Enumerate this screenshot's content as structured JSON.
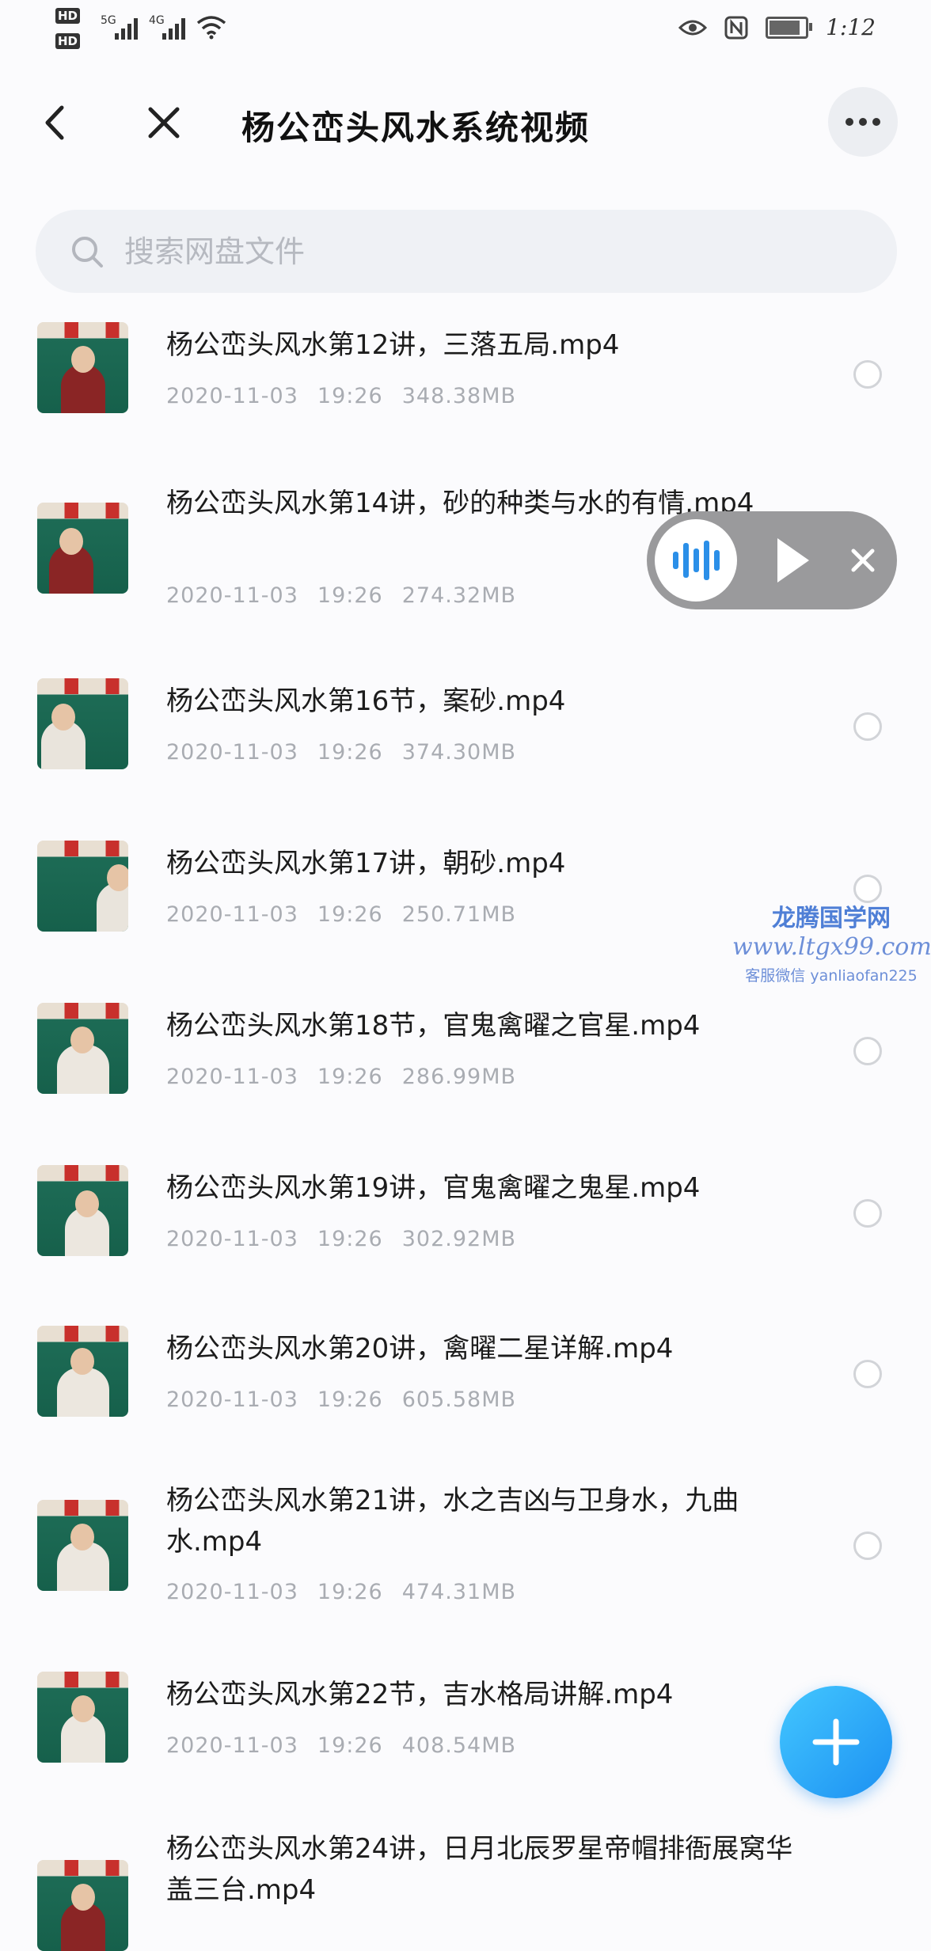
{
  "status_bar": {
    "hd1": "HD",
    "hd2": "HD",
    "sim1": "5G",
    "sim2": "4G",
    "time": "1:12"
  },
  "header": {
    "title": "杨公峦头风水系统视频"
  },
  "search": {
    "placeholder": "搜索网盘文件"
  },
  "files": [
    {
      "name": "杨公峦头风水第12讲，三落五局.mp4",
      "date": "2020-11-03",
      "time": "19:26",
      "size": "348.38MB"
    },
    {
      "name": "杨公峦头风水第14讲，砂的种类与水的有情.mp4",
      "date": "2020-11-03",
      "time": "19:26",
      "size": "274.32MB"
    },
    {
      "name": "杨公峦头风水第16节，案砂.mp4",
      "date": "2020-11-03",
      "time": "19:26",
      "size": "374.30MB"
    },
    {
      "name": "杨公峦头风水第17讲，朝砂.mp4",
      "date": "2020-11-03",
      "time": "19:26",
      "size": "250.71MB"
    },
    {
      "name": "杨公峦头风水第18节，官鬼禽曜之官星.mp4",
      "date": "2020-11-03",
      "time": "19:26",
      "size": "286.99MB"
    },
    {
      "name": "杨公峦头风水第19讲，官鬼禽曜之鬼星.mp4",
      "date": "2020-11-03",
      "time": "19:26",
      "size": "302.92MB"
    },
    {
      "name": "杨公峦头风水第20讲，禽曜二星详解.mp4",
      "date": "2020-11-03",
      "time": "19:26",
      "size": "605.58MB"
    },
    {
      "name": "杨公峦头风水第21讲，水之吉凶与卫身水，九曲水.mp4",
      "date": "2020-11-03",
      "time": "19:26",
      "size": "474.31MB"
    },
    {
      "name": "杨公峦头风水第22节，吉水格局讲解.mp4",
      "date": "2020-11-03",
      "time": "19:26",
      "size": "408.54MB"
    },
    {
      "name": "杨公峦头风水第24讲，日月北辰罗星帝帽排衙展窝华盖三台.mp4",
      "date": "",
      "time": "",
      "size": ""
    }
  ],
  "watermark": {
    "name": "龙腾国学网",
    "url": "www.ltgx99.com",
    "contact": "客服微信 yanliaofan225"
  },
  "icons": {
    "back": "chevron-left-icon",
    "close": "close-icon",
    "more": "more-icon",
    "search": "search-icon",
    "add": "plus-icon"
  },
  "colors": {
    "accent": "#1c90f2",
    "background": "#fbfbfd"
  }
}
